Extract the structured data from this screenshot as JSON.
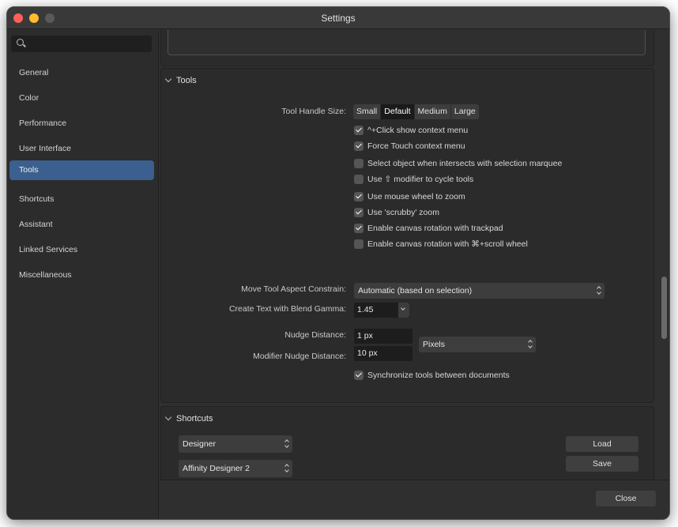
{
  "window": {
    "title": "Settings"
  },
  "sidebar": {
    "search_placeholder": "",
    "items": [
      {
        "label": "General"
      },
      {
        "label": "Color"
      },
      {
        "label": "Performance"
      },
      {
        "label": "User Interface"
      },
      {
        "label": "Tools",
        "active": true
      },
      {
        "label": "Shortcuts"
      },
      {
        "label": "Assistant"
      },
      {
        "label": "Linked Services"
      },
      {
        "label": "Miscellaneous"
      }
    ]
  },
  "tools": {
    "heading": "Tools",
    "handle_size": {
      "label": "Tool Handle Size:",
      "options": [
        "Small",
        "Default",
        "Medium",
        "Large"
      ],
      "selected": "Default"
    },
    "checkboxes": [
      {
        "label": "^+Click show context menu",
        "checked": true
      },
      {
        "label": "Force Touch context menu",
        "checked": true
      },
      {
        "label": "Select object when intersects with selection marquee",
        "checked": false
      },
      {
        "label": "Use ⇧ modifier to cycle tools",
        "checked": false
      },
      {
        "label": "Use mouse wheel to zoom",
        "checked": true
      },
      {
        "label": "Use 'scrubby' zoom",
        "checked": true
      },
      {
        "label": "Enable canvas rotation with trackpad",
        "checked": true
      },
      {
        "label": "Enable canvas rotation with ⌘+scroll wheel",
        "checked": false
      }
    ],
    "move_tool": {
      "label": "Move Tool Aspect Constrain:",
      "value": "Automatic (based on selection)"
    },
    "blend_gamma": {
      "label": "Create Text with Blend Gamma:",
      "value": "1.45"
    },
    "nudge": {
      "label": "Nudge Distance:",
      "value": "1 px"
    },
    "modifier_nudge": {
      "label": "Modifier Nudge Distance:",
      "value": "10 px"
    },
    "units": {
      "value": "Pixels"
    },
    "sync": {
      "label": "Synchronize tools between documents",
      "checked": true
    }
  },
  "shortcuts": {
    "heading": "Shortcuts",
    "app_select": "Designer",
    "preset_select": "Affinity Designer 2",
    "load_label": "Load",
    "save_label": "Save"
  },
  "footer": {
    "close_label": "Close"
  },
  "colors": {
    "accent": "#3b5f8f",
    "window_bg": "#2f2f2f",
    "panel_bg": "#2b2b2b"
  }
}
